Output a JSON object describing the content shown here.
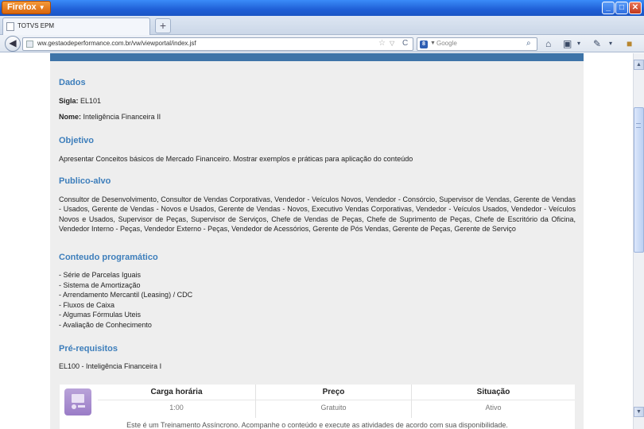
{
  "browser": {
    "menu_label": "Firefox",
    "tab_title": "TOTVS EPM",
    "new_tab_symbol": "+",
    "url": "ww.gestaodeperformance.com.br/vw/viewportal/index.jsf",
    "search_engine_label": "Google",
    "search_engine_letter": "8"
  },
  "content": {
    "dados": {
      "title": "Dados",
      "sigla_label": "Sigla:",
      "sigla_value": "EL101",
      "nome_label": "Nome:",
      "nome_value": "Inteligência Financeira II"
    },
    "objetivo": {
      "title": "Objetivo",
      "text": "Apresentar Conceitos básicos de Mercado Financeiro. Mostrar exemplos e práticas para aplicação do conteúdo"
    },
    "publico": {
      "title": "Publico-alvo",
      "text": "Consultor de Desenvolvimento, Consultor de Vendas Corporativas, Vendedor - Veículos Novos, Vendedor - Consórcio, Supervisor de Vendas, Gerente de Vendas - Usados, Gerente de Vendas - Novos e Usados, Gerente de Vendas - Novos, Executivo Vendas Corporativas, Vendedor - Veículos Usados, Vendedor - Veículos Novos e Usados, Supervisor de Peças, Supervisor de Serviços, Chefe de Vendas de Peças, Chefe de Suprimento de Peças, Chefe de Escritório da Oficina, Vendedor Interno - Peças, Vendedor Externo - Peças, Vendedor de Acessórios, Gerente de Pós Vendas, Gerente de Peças, Gerente de Serviço"
    },
    "conteudo": {
      "title": "Conteudo programático",
      "items": [
        "- Série de Parcelas Iguais",
        "- Sistema de Amortização",
        "- Arrendamento Mercantil (Leasing) / CDC",
        "- Fluxos de Caixa",
        "- Algumas Fórmulas Uteis",
        "- Avaliação de Conhecimento"
      ]
    },
    "prereq": {
      "title": "Pré-requisitos",
      "text": "EL100 - Inteligência Financeira I"
    },
    "info": {
      "carga_label": "Carga horária",
      "carga_value": "1:00",
      "preco_label": "Preço",
      "preco_value": "Gratuito",
      "situacao_label": "Situação",
      "situacao_value": "Ativo",
      "note": "Este é um Treinamento Assíncrono. Acompanhe o conteúdo e execute as atividades de acordo com sua disponibilidade."
    }
  },
  "colors": {
    "section_title": "#3d7ebb",
    "panel_bar": "#3e74a8",
    "panel_bg": "#eeeeee"
  }
}
